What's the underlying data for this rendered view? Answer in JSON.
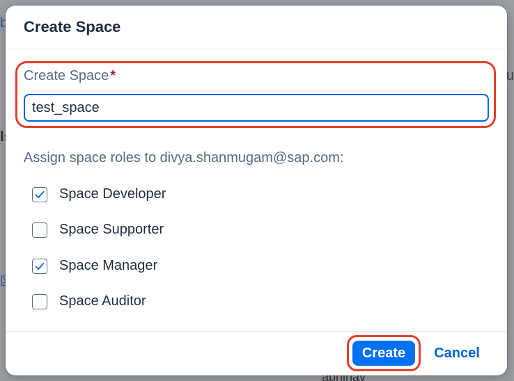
{
  "background": {
    "left_top": "b",
    "left_mid": "ls",
    "left_icon": "☒",
    "right_top": "u",
    "bottom": "abhinay"
  },
  "dialog": {
    "title": "Create Space",
    "field": {
      "label": "Create Space",
      "required_marker": "*",
      "value": "test_space"
    },
    "assign_label": "Assign space roles to divya.shanmugam@sap.com:",
    "roles": [
      {
        "label": "Space Developer",
        "checked": true
      },
      {
        "label": "Space Supporter",
        "checked": false
      },
      {
        "label": "Space Manager",
        "checked": true
      },
      {
        "label": "Space Auditor",
        "checked": false
      }
    ],
    "footer": {
      "create_label": "Create",
      "cancel_label": "Cancel"
    }
  },
  "colors": {
    "accent": "#0070f2",
    "highlight": "#e0402a",
    "required": "#aa0e5d"
  }
}
